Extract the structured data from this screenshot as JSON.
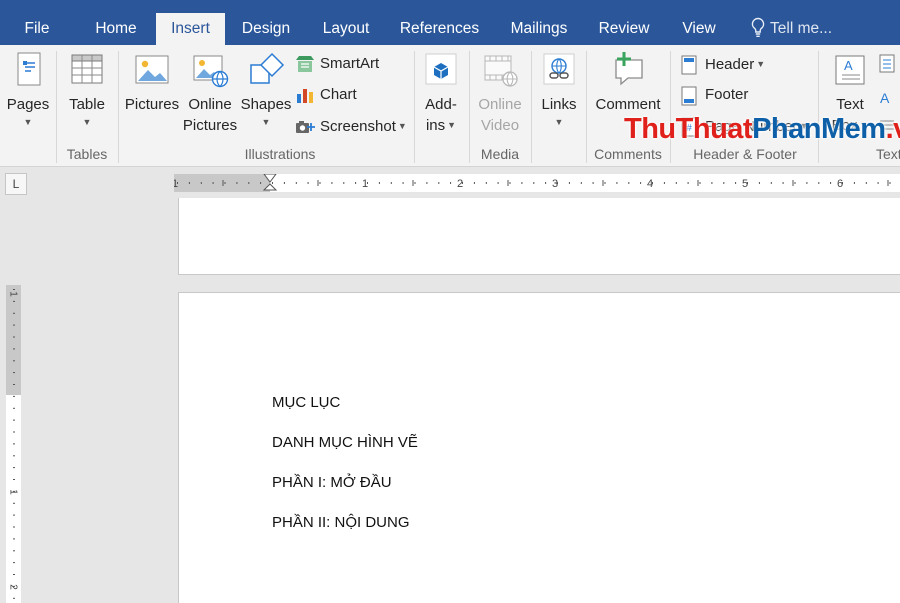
{
  "tabs": {
    "file": "File",
    "home": "Home",
    "insert": "Insert",
    "design": "Design",
    "layout": "Layout",
    "references": "References",
    "mailings": "Mailings",
    "review": "Review",
    "view": "View",
    "tell_me": "Tell me..."
  },
  "ribbon": {
    "pages": "Pages",
    "table": "Table",
    "pictures": "Pictures",
    "online_pictures_1": "Online",
    "online_pictures_2": "Pictures",
    "shapes": "Shapes",
    "smartart": "SmartArt",
    "chart": "Chart",
    "screenshot": "Screenshot",
    "addins_1": "Add-",
    "addins_2": "ins",
    "online_video_1": "Online",
    "online_video_2": "Video",
    "links": "Links",
    "comment": "Comment",
    "header": "Header",
    "footer": "Footer",
    "page_number": "Page Number",
    "text_box_1": "Text",
    "text_box_2": "Box",
    "groups": {
      "tables": "Tables",
      "illustrations": "Illustrations",
      "media": "Media",
      "comments": "Comments",
      "header_footer": "Header & Footer",
      "text": "Text"
    }
  },
  "ruler": {
    "tab_selector": "L",
    "h_labels": [
      "1",
      "1",
      "2",
      "3",
      "4",
      "5",
      "6"
    ],
    "v_labels": [
      "1",
      "1",
      "2"
    ]
  },
  "watermark": {
    "part1": "ThuThuat",
    "part2": "PhanMem",
    "part3": ".vn"
  },
  "document": {
    "lines": [
      "MỤC LỤC",
      "DANH MỤC HÌNH VẼ",
      "PHẦN I: MỞ ĐẦU",
      "PHẦN II: NỘI DUNG"
    ]
  },
  "colors": {
    "tabbar": "#2b579a",
    "ribbon": "#f3f3f3",
    "watermark_red": "#e0211b",
    "watermark_blue": "#0d5fa8"
  }
}
